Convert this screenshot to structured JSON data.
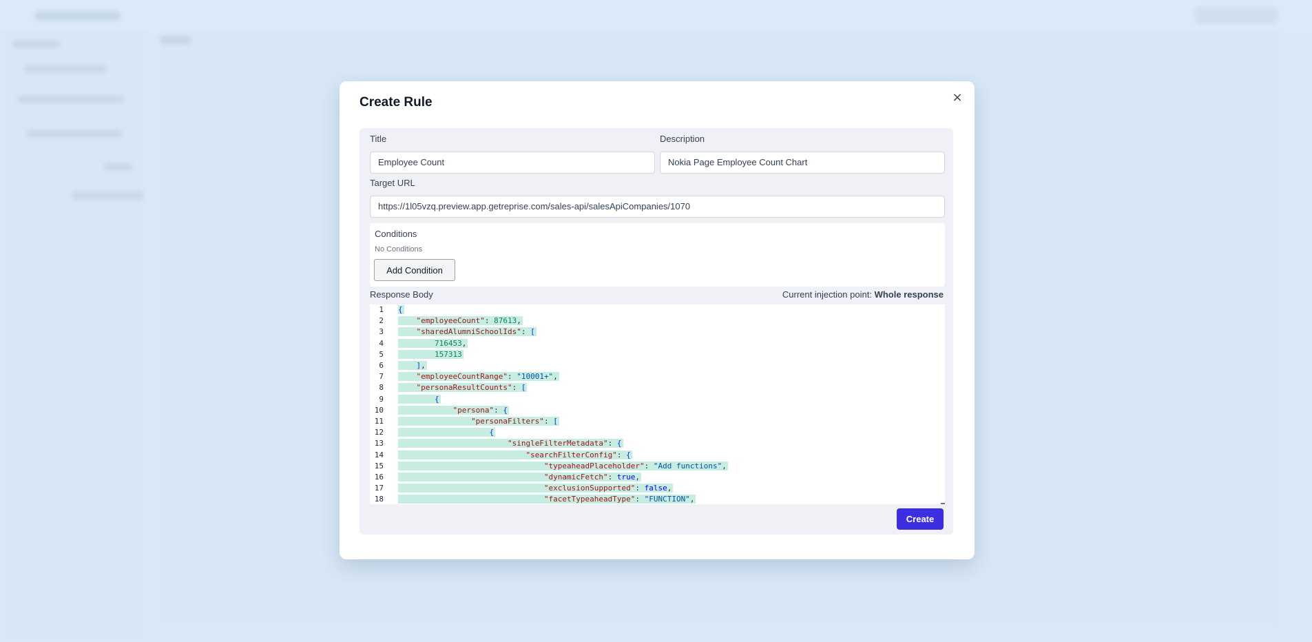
{
  "modal": {
    "title": "Create Rule",
    "close_icon": "×",
    "title_label": "Title",
    "title_value": "Employee Count",
    "description_label": "Description",
    "description_value": "Nokia Page Employee Count Chart",
    "target_url_label": "Target URL",
    "target_url_value": "https://1l05vzq.preview.app.getreprise.com/sales-api/salesApiCompanies/1070",
    "conditions_title": "Conditions",
    "conditions_empty": "No Conditions",
    "add_condition_label": "Add Condition",
    "response_body_label": "Response Body",
    "injection_point_prefix": "Current injection point:",
    "injection_point_value": "Whole response",
    "create_label": "Create"
  },
  "code": {
    "line_numbers": [
      "1",
      "2",
      "3",
      "4",
      "5",
      "6",
      "7",
      "8",
      "9",
      "10",
      "11",
      "12",
      "13",
      "14",
      "15",
      "16",
      "17",
      "18"
    ],
    "lines": [
      "{",
      "    \"employeeCount\": 87613,",
      "    \"sharedAlumniSchoolIds\": [",
      "        716453,",
      "        157313",
      "    ],",
      "    \"employeeCountRange\": \"10001+\",",
      "    \"personaResultCounts\": [",
      "        {",
      "            \"persona\": {",
      "                \"personaFilters\": [",
      "                    {",
      "                        \"singleFilterMetadata\": {",
      "                            \"searchFilterConfig\": {",
      "                                \"typeaheadPlaceholder\": \"Add functions\",",
      "                                \"dynamicFetch\": true,",
      "                                \"exclusionSupported\": false,",
      "                                \"facetTypeaheadType\": \"FUNCTION\","
    ]
  },
  "colors": {
    "accent": "#3b2fe0",
    "code_highlight": "#c7ede3",
    "backdrop": "#d9e9f8"
  }
}
